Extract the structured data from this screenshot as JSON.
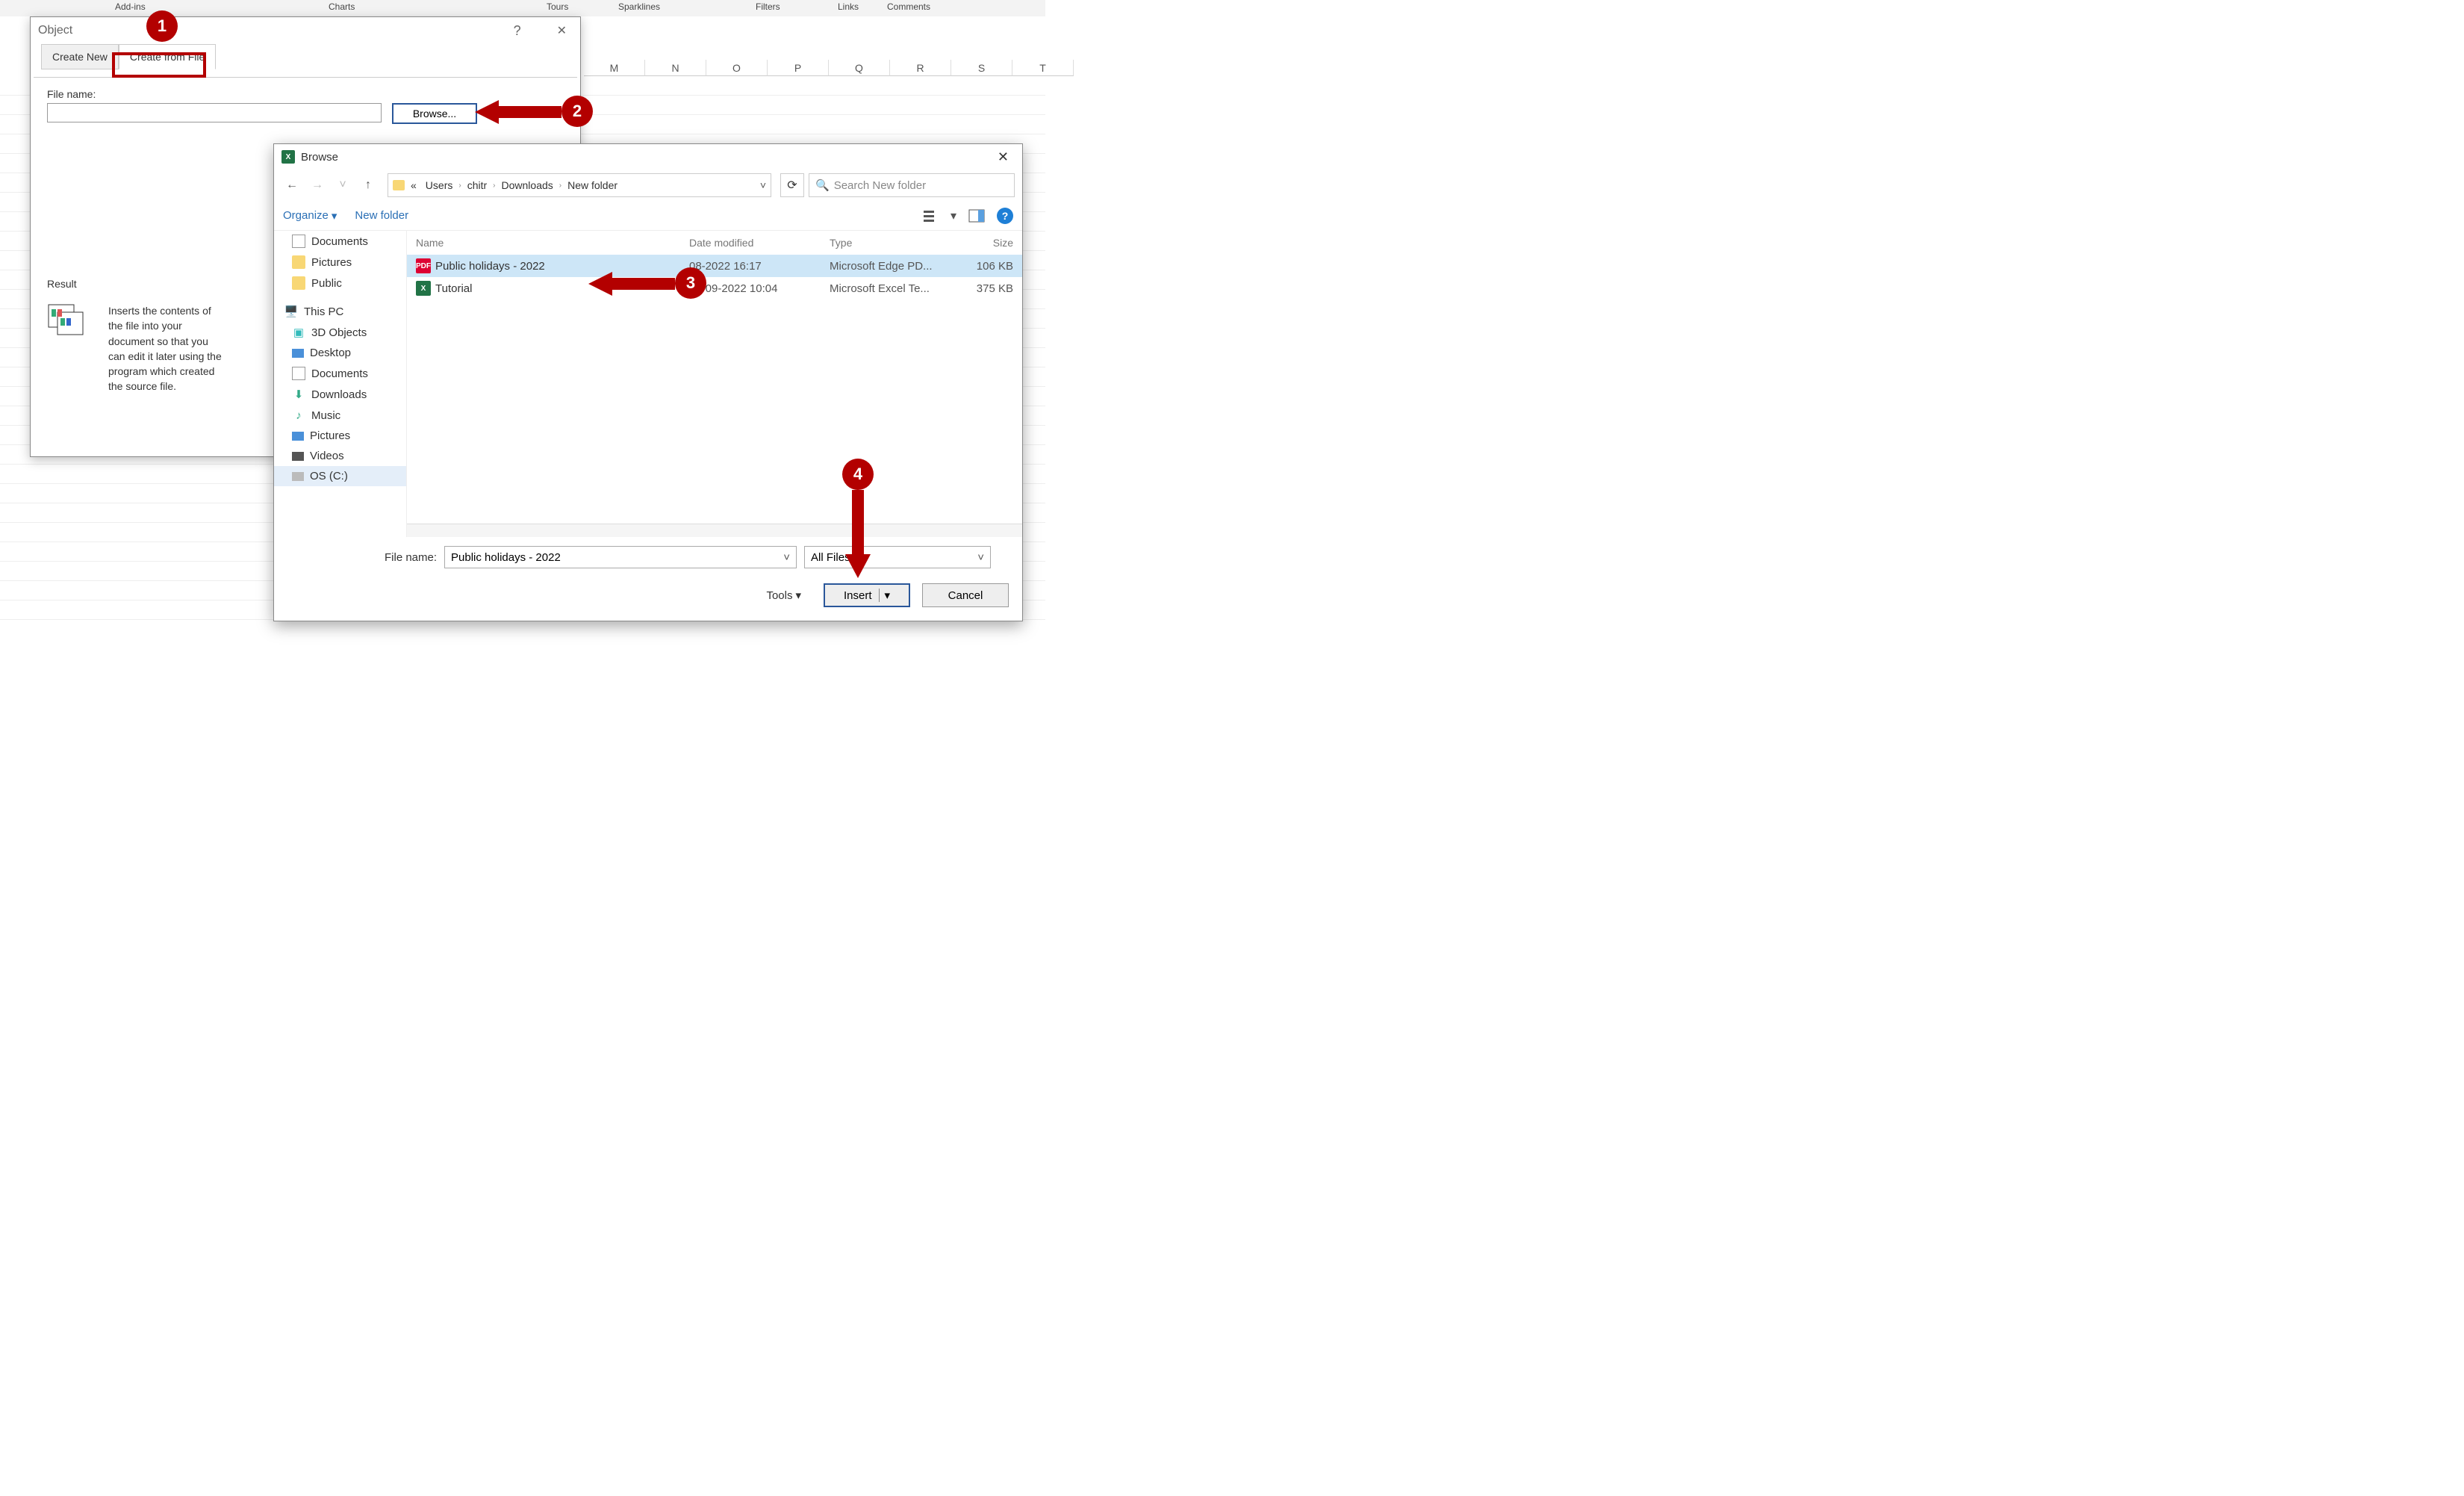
{
  "ribbon_groups": {
    "addins": "Add-ins",
    "charts": "Charts",
    "tours": "Tours",
    "sparklines": "Sparklines",
    "filters": "Filters",
    "links": "Links",
    "comments": "Comments"
  },
  "columns": [
    "M",
    "N",
    "O",
    "P",
    "Q",
    "R",
    "S",
    "T"
  ],
  "object_dialog": {
    "title": "Object",
    "help": "?",
    "tabs": {
      "create_new": "Create New",
      "create_from_file": "Create from File"
    },
    "file_name_label": "File name:",
    "browse": "Browse...",
    "result_label": "Result",
    "result_text": "Inserts the contents of the file into your document so that you can edit it later using the program which created the source file."
  },
  "browse_dialog": {
    "title": "Browse",
    "breadcrumb": {
      "prefix": "«",
      "segs": [
        "Users",
        "chitr",
        "Downloads",
        "New folder"
      ]
    },
    "search_placeholder": "Search New folder",
    "organize": "Organize",
    "new_folder": "New folder",
    "tree": [
      {
        "label": "Documents",
        "icon": "doc"
      },
      {
        "label": "Pictures",
        "icon": "folder"
      },
      {
        "label": "Public",
        "icon": "folder"
      },
      {
        "label": "",
        "icon": "blank"
      },
      {
        "label": "This PC",
        "icon": "pc"
      },
      {
        "label": "3D Objects",
        "icon": "3d"
      },
      {
        "label": "Desktop",
        "icon": "desktop"
      },
      {
        "label": "Documents",
        "icon": "doc"
      },
      {
        "label": "Downloads",
        "icon": "download"
      },
      {
        "label": "Music",
        "icon": "music"
      },
      {
        "label": "Pictures",
        "icon": "pictures"
      },
      {
        "label": "Videos",
        "icon": "videos"
      },
      {
        "label": "OS (C:)",
        "icon": "disk"
      }
    ],
    "headers": {
      "name": "Name",
      "date": "Date modified",
      "type": "Type",
      "size": "Size"
    },
    "files": [
      {
        "name": "Public holidays - 2022",
        "date": "08-2022 16:17",
        "type": "Microsoft Edge PD...",
        "size": "106 KB",
        "icon": "pdf",
        "selected": true
      },
      {
        "name": "Tutorial",
        "date": "20-09-2022 10:04",
        "type": "Microsoft Excel Te...",
        "size": "375 KB",
        "icon": "xlsx",
        "selected": false
      }
    ],
    "footer": {
      "file_name_label": "File name:",
      "file_name_value": "Public holidays - 2022",
      "filter": "All Files",
      "tools": "Tools",
      "insert": "Insert",
      "cancel": "Cancel"
    }
  },
  "annotations": {
    "1": "1",
    "2": "2",
    "3": "3",
    "4": "4"
  }
}
